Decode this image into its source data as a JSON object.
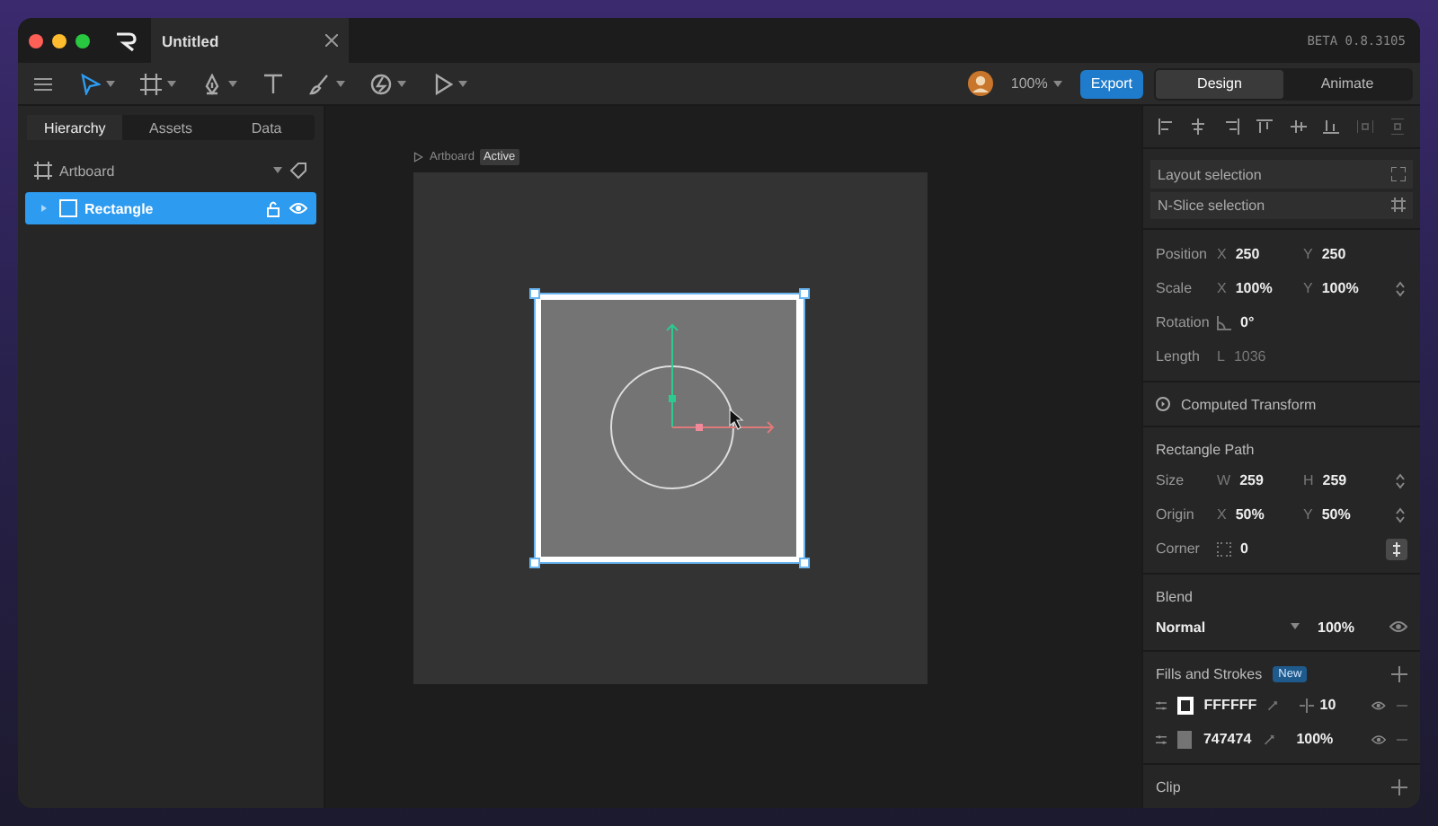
{
  "window": {
    "title": "Untitled",
    "version": "BETA 0.8.3105"
  },
  "toolbar": {
    "zoom": "100%",
    "export": "Export",
    "modes": [
      {
        "label": "Design",
        "selected": true
      },
      {
        "label": "Animate",
        "selected": false
      }
    ]
  },
  "sidebar": {
    "tabs": [
      {
        "label": "Hierarchy",
        "selected": true
      },
      {
        "label": "Assets",
        "selected": false
      },
      {
        "label": "Data",
        "selected": false
      }
    ],
    "layers": [
      {
        "name": "Artboard",
        "kind": "artboard",
        "selected": false
      },
      {
        "name": "Rectangle",
        "kind": "shape",
        "selected": true
      }
    ]
  },
  "canvas": {
    "artboard_label": "Artboard",
    "artboard_badge": "Active"
  },
  "inspector": {
    "buttons": [
      "Layout selection",
      "N-Slice selection"
    ],
    "transform": [
      {
        "label": "Position",
        "disabled": false,
        "kind": "plain",
        "fields": [
          {
            "kind": "axis",
            "axis": "X",
            "value": "250"
          },
          {
            "kind": "axis",
            "axis": "Y",
            "value": "250"
          }
        ]
      },
      {
        "label": "Scale",
        "disabled": false,
        "kind": "stepper",
        "fields": [
          {
            "kind": "axis",
            "axis": "X",
            "value": "100%"
          },
          {
            "kind": "axis",
            "axis": "Y",
            "value": "100%"
          }
        ]
      },
      {
        "label": "Rotation",
        "disabled": false,
        "kind": "plain",
        "fields": [
          {
            "kind": "angle",
            "value": "0°"
          }
        ]
      },
      {
        "label": "Length",
        "disabled": true,
        "kind": "plain",
        "fields": [
          {
            "kind": "axis",
            "axis": "L",
            "value": "1036"
          }
        ]
      }
    ],
    "computed_transform": "Computed Transform",
    "path": {
      "title": "Rectangle Path",
      "rows": [
        {
          "label": "Size",
          "disabled": false,
          "kind": "stepper",
          "fields": [
            {
              "kind": "axis",
              "axis": "W",
              "value": "259"
            },
            {
              "kind": "axis",
              "axis": "H",
              "value": "259"
            }
          ]
        },
        {
          "label": "Origin",
          "disabled": false,
          "kind": "stepper",
          "fields": [
            {
              "kind": "axis",
              "axis": "X",
              "value": "50%"
            },
            {
              "kind": "axis",
              "axis": "Y",
              "value": "50%"
            }
          ]
        },
        {
          "label": "Corner",
          "disabled": false,
          "kind": "toggle",
          "fields": [
            {
              "kind": "corner",
              "value": "0"
            }
          ]
        }
      ]
    },
    "blend": {
      "title": "Blend",
      "mode": "Normal",
      "opacity": "100%"
    },
    "fills": {
      "title": "Fills and Strokes",
      "badge": "New",
      "items": [
        {
          "kind": "stroke",
          "color": "#ffffff",
          "hex": "FFFFFF",
          "amount": "10"
        },
        {
          "kind": "fill",
          "color": "#747474",
          "hex": "747474",
          "amount": "100%"
        }
      ]
    },
    "clip": {
      "title": "Clip"
    }
  }
}
